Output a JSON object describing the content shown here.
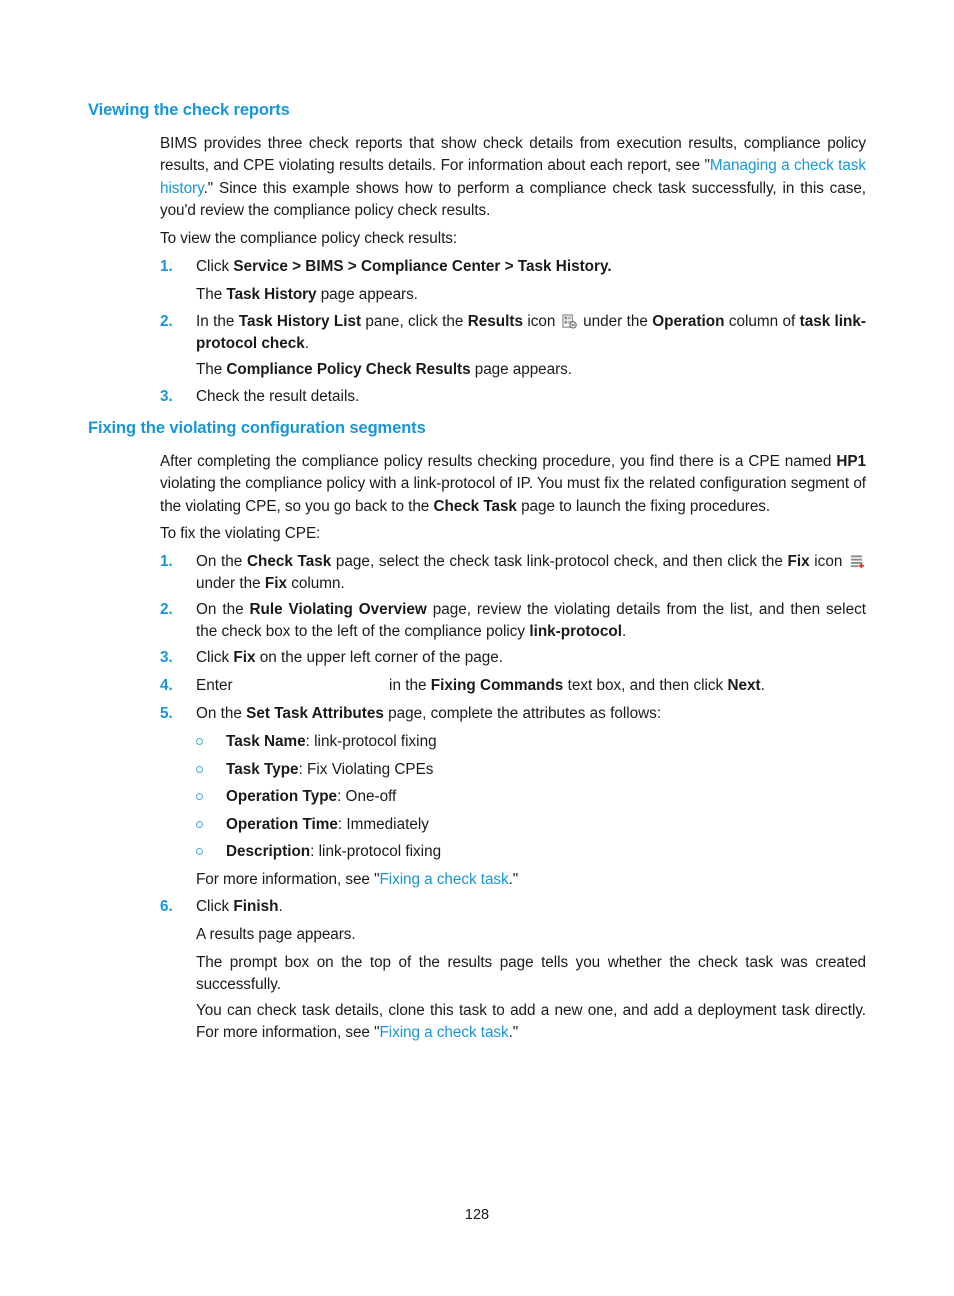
{
  "page": {
    "number": "128"
  },
  "sections": [
    {
      "heading": "Viewing the check reports",
      "intro": {
        "p1_a": "BIMS provides three check reports that show check details from execution results, compliance policy results, and CPE violating results details. For information about each report, see \"",
        "p1_link": "Managing a check task history",
        "p1_b": ".\" Since this example shows how to perform a compliance check task successfully, in this case, you'd review the compliance policy check results.",
        "lead_in": "To view the compliance policy check results:"
      },
      "steps": {
        "s1_num": "1.",
        "s1_a": "Click ",
        "s1_bold": "Service > BIMS > Compliance Center > Task History.",
        "s1_result_a": "The ",
        "s1_result_bold": "Task History",
        "s1_result_b": " page appears.",
        "s2_num": "2.",
        "s2_a": "In the ",
        "s2_bold1": "Task History List",
        "s2_b": " pane, click the ",
        "s2_bold2": "Results",
        "s2_c": " icon ",
        "s2_icon": "results-report-icon",
        "s2_d": " under the ",
        "s2_bold3": "Operation",
        "s2_e": " column of ",
        "s2_bold4": "task link-protocol check",
        "s2_f": ".",
        "s2_result_a": "The ",
        "s2_result_bold": "Compliance Policy Check Results",
        "s2_result_b": " page appears.",
        "s3_num": "3.",
        "s3_a": "Check the result details."
      }
    },
    {
      "heading": "Fixing the violating configuration segments",
      "intro": {
        "p1_a": "After completing the compliance policy results checking procedure, you find there is a CPE named ",
        "p1_bold1": "HP1",
        "p1_b": " violating the compliance policy with a link-protocol of IP. You must fix the related configuration segment of the violating CPE, so you go back to the ",
        "p1_bold2": "Check Task",
        "p1_c": " page to launch the fixing procedures.",
        "lead_in": "To fix the violating CPE:"
      },
      "steps": {
        "s1_num": "1.",
        "s1_a": "On the ",
        "s1_bold1": "Check Task",
        "s1_b": " page, select the check task link-protocol check, and then click the ",
        "s1_bold2": "Fix",
        "s1_c": " icon ",
        "s1_icon": "fix-add-icon",
        "s1_d": " under the ",
        "s1_bold3": "Fix",
        "s1_e": " column.",
        "s2_num": "2.",
        "s2_a": "On the ",
        "s2_bold1": "Rule Violating Overview",
        "s2_b": " page, review the violating details from the list, and then select the check box to the left of the compliance policy ",
        "s2_bold2": "link-protocol",
        "s2_c": ".",
        "s3_num": "3.",
        "s3_a": "Click ",
        "s3_bold": "Fix",
        "s3_b": " on the upper left corner of the page.",
        "s4_num": "4.",
        "s4_a": "Enter ",
        "s4_value": "",
        "s4_b": " in the ",
        "s4_bold1": "Fixing Commands",
        "s4_c": " text box, and then click ",
        "s4_bold2": "Next",
        "s4_d": ".",
        "s5_num": "5.",
        "s5_a": "On the ",
        "s5_bold": "Set Task Attributes",
        "s5_b": " page, complete the attributes as follows:",
        "s6_num": "6.",
        "s6_a": "Click ",
        "s6_bold": "Finish",
        "s6_b": "."
      },
      "attributes": [
        {
          "label": "Task Name",
          "value": ": link-protocol fixing"
        },
        {
          "label": "Task Type",
          "value": ": Fix Violating CPEs"
        },
        {
          "label": "Operation Type",
          "value": ": One-off"
        },
        {
          "label": "Operation Time",
          "value": ": Immediately"
        },
        {
          "label": "Description",
          "value": ": link-protocol fixing"
        }
      ],
      "after_attributes": {
        "a": "For more information, see \"",
        "link": "Fixing a check task",
        "b": ".\""
      },
      "tail": {
        "t1": "A results page appears.",
        "t2": "The prompt box on the top of the results page tells you whether the check task was created successfully.",
        "t3_a": "You can check task details, clone this task to add a new one, and add a deployment task directly. For more information, see \"",
        "t3_link": "Fixing a check task",
        "t3_b": ".\""
      }
    }
  ],
  "colors": {
    "heading_blue": "#1896d6",
    "link_blue": "#1896d6",
    "bullet_blue": "#4aa8dd",
    "fix_icon_red": "#e8301c",
    "text": "#1a1a1a"
  }
}
